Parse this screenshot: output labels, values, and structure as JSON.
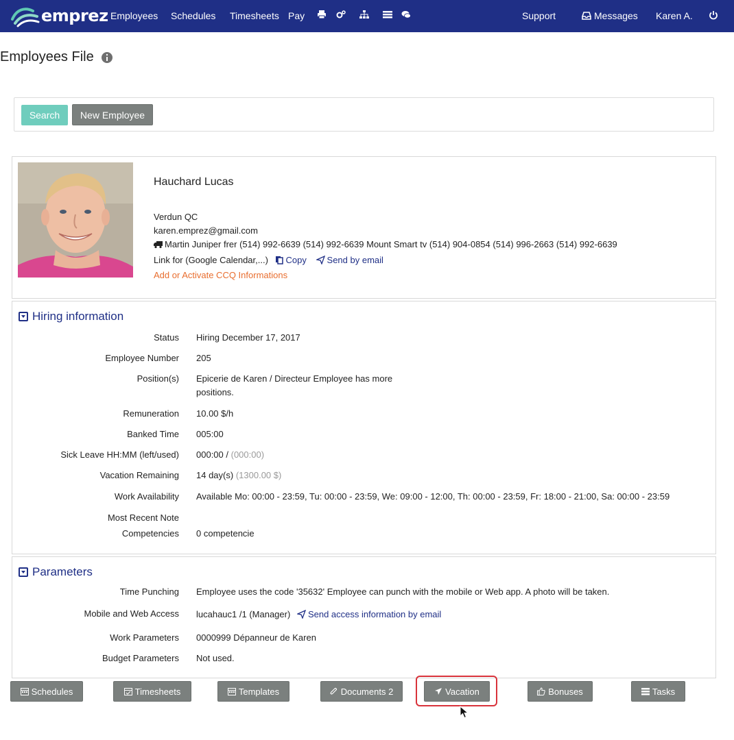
{
  "nav": {
    "brand": "emprez",
    "items": [
      "Employees",
      "Schedules",
      "Timesheets",
      "Pay"
    ],
    "support": "Support",
    "messages": "Messages",
    "user": "Karen A.",
    "icons": [
      "print-icon",
      "cogs-icon",
      "sitemap-icon",
      "list-icon",
      "comments-icon"
    ]
  },
  "page": {
    "title": "Employees File"
  },
  "search": {
    "search_label": "Search",
    "new_label": "New Employee"
  },
  "employee": {
    "name": "Hauchard Lucas",
    "city": "Verdun QC",
    "email": "karen.emprez@gmail.com",
    "phones": "Martin Juniper frer (514) 992-6639 (514) 992-6639 Mount Smart tv (514) 904-0854 (514) 996-2663 (514) 992-6639",
    "link_label": "Link for (Google Calendar,...)",
    "copy_label": "Copy",
    "send_email_label": "Send by email",
    "ccq_label": "Add or Activate CCQ Informations"
  },
  "hiring": {
    "title": "Hiring information",
    "rows": [
      {
        "label": "Status",
        "value": "Hiring December 17, 2017"
      },
      {
        "label": "Employee Number",
        "value": "205"
      },
      {
        "label": "Position(s)",
        "value": "Epicerie de Karen / Directeur Employee has more",
        "value2": "positions."
      },
      {
        "label": "Remuneration",
        "value": "10.00 $/h"
      },
      {
        "label": "Banked Time",
        "value": "005:00"
      },
      {
        "label": "Sick Leave HH:MM (left/used)",
        "value": "000:00 /",
        "muted": "(000:00)"
      },
      {
        "label": "Vacation Remaining",
        "value": "14 day(s)",
        "muted": "(1300.00 $)"
      },
      {
        "label": "Work Availability",
        "value": "Available Mo: 00:00 - 23:59, Tu: 00:00 - 23:59, We: 09:00 - 12:00, Th: 00:00 - 23:59, Fr: 18:00 - 21:00, Sa: 00:00 - 23:59"
      },
      {
        "label": "Most Recent Note",
        "value": ""
      },
      {
        "label": "Competencies",
        "value": "0 competencie"
      }
    ]
  },
  "parameters": {
    "title": "Parameters",
    "rows": [
      {
        "label": "Time Punching",
        "value": "Employee uses the code '35632' Employee can punch with the mobile or Web app. A photo will be taken."
      },
      {
        "label": "Mobile and Web Access",
        "value": "lucahauc1 /1 (Manager)",
        "link": "Send access information by email"
      },
      {
        "label": "Work Parameters",
        "value": "0000999 Dépanneur de Karen"
      },
      {
        "label": "Budget Parameters",
        "value": "Not used."
      }
    ]
  },
  "bottom_buttons": [
    "Schedules",
    "Timesheets",
    "Templates",
    "Documents 2",
    "Vacation",
    "Bonuses",
    "Tasks"
  ],
  "colors": {
    "navbar": "#1f2f86",
    "search_button": "#6fcdbd",
    "button_gray": "#7b807e",
    "ccq_link": "#e86d2e",
    "highlight": "#d9323a"
  }
}
